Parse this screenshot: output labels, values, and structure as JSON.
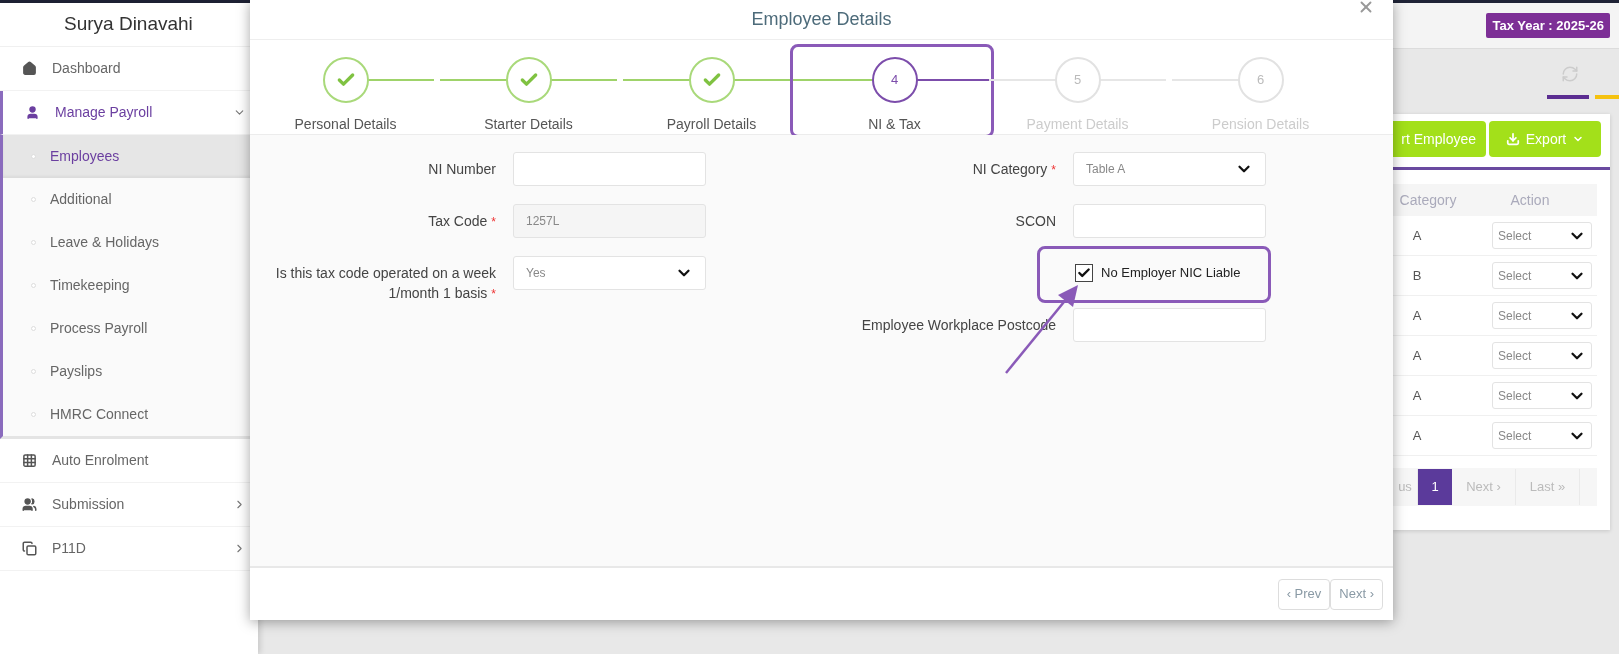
{
  "sidebar": {
    "user_name": "Surya Dinavahi",
    "items": [
      {
        "label": "Dashboard",
        "kind": "home",
        "selected": false
      },
      {
        "label": "Manage Payroll",
        "kind": "user",
        "selected": false,
        "expanded": true,
        "children": [
          {
            "label": "Employees",
            "selected": true
          },
          {
            "label": "Additional",
            "selected": false
          },
          {
            "label": "Leave & Holidays",
            "selected": false
          },
          {
            "label": "Timekeeping",
            "selected": false
          },
          {
            "label": "Process Payroll",
            "selected": false
          },
          {
            "label": "Payslips",
            "selected": false
          },
          {
            "label": "HMRC Connect",
            "selected": false
          }
        ]
      },
      {
        "label": "Auto Enrolment",
        "kind": "grid",
        "selected": false
      },
      {
        "label": "Submission",
        "kind": "users",
        "selected": false,
        "expanded": false
      },
      {
        "label": "P11D",
        "kind": "copy",
        "selected": false,
        "expanded": false
      }
    ]
  },
  "header": {
    "tax_year": "Tax Year : 2025-26"
  },
  "employee_panel": {
    "buttons": [
      {
        "label": "rt Employee",
        "kind": "plain"
      },
      {
        "label": "Export",
        "kind": "dropdown"
      }
    ],
    "table": {
      "columns": [
        "Category",
        "Action"
      ],
      "rows": [
        {
          "category": "A",
          "action": "Select"
        },
        {
          "category": "B",
          "action": "Select"
        },
        {
          "category": "A",
          "action": "Select"
        },
        {
          "category": "A",
          "action": "Select"
        },
        {
          "category": "A",
          "action": "Select"
        },
        {
          "category": "A",
          "action": "Select"
        }
      ]
    },
    "pagination": [
      {
        "label": "us",
        "selected": false
      },
      {
        "label": "1",
        "selected": true
      },
      {
        "label": "Next ›",
        "selected": false
      },
      {
        "label": "Last »",
        "selected": false
      }
    ]
  },
  "dialog": {
    "title": "Employee Details",
    "steps": [
      {
        "label": "Personal Details",
        "kind": "done",
        "highlighted": false
      },
      {
        "label": "Starter Details",
        "kind": "done",
        "highlighted": false
      },
      {
        "label": "Payroll Details",
        "kind": "done",
        "highlighted": false
      },
      {
        "number": "4",
        "label": "NI & Tax",
        "kind": "current",
        "highlighted": true
      },
      {
        "number": "5",
        "label": "Payment Details",
        "kind": "pending",
        "highlighted": false
      },
      {
        "number": "6",
        "label": "Pension Details",
        "kind": "pending",
        "highlighted": false
      }
    ],
    "left_fields": [
      {
        "kind": "text",
        "label": "NI Number"
      },
      {
        "kind": "text",
        "label": "Tax Code",
        "required_mark": "*",
        "value": "1257L"
      },
      {
        "kind": "select",
        "label": "Is this tax code operated on a week 1/month 1 basis",
        "required_mark": "*",
        "value": "Yes"
      }
    ],
    "right_fields": [
      {
        "kind": "select",
        "label": "NI Category",
        "required_mark": "*",
        "value": "Table A"
      },
      {
        "kind": "text",
        "label": "SCON"
      },
      {
        "kind": "checkbox",
        "label": "No Employer NIC Liable",
        "checked": true,
        "highlighted": true
      },
      {
        "kind": "text",
        "label": "Employee Workplace Postcode"
      }
    ],
    "footer_buttons": [
      "‹ Prev",
      "Next ›"
    ]
  }
}
